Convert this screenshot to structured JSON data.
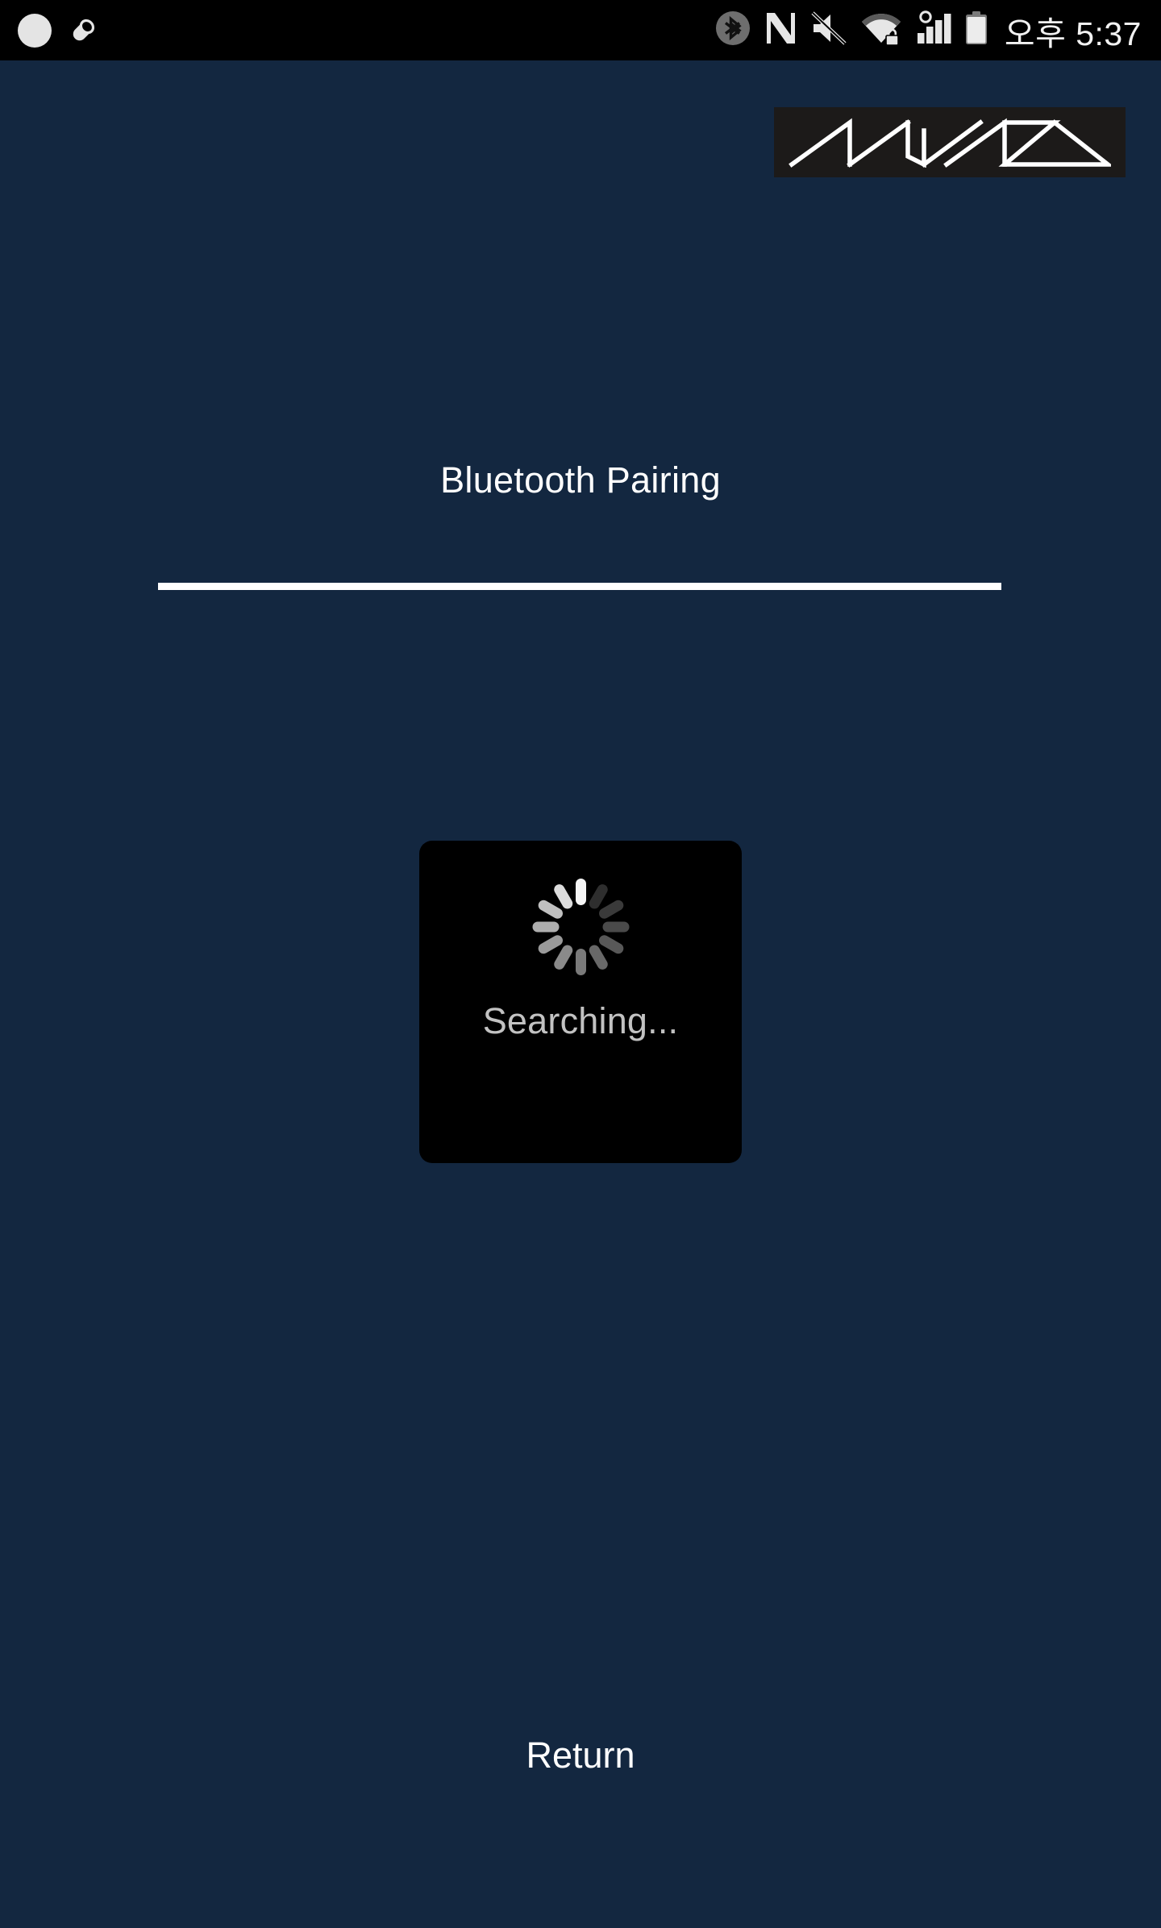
{
  "status_bar": {
    "background_color": "#000000",
    "left_icons": [
      {
        "name": "notification-dot-icon",
        "glyph": "circle"
      },
      {
        "name": "capsule-notification-icon",
        "glyph": "pill"
      }
    ],
    "right_icons": [
      {
        "name": "bluetooth-icon",
        "label": "Bluetooth",
        "color": "#6e6e6e"
      },
      {
        "name": "nfc-icon",
        "label": "NFC",
        "color": "#e6e6e6"
      },
      {
        "name": "volume-mute-icon",
        "label": "Muted",
        "color": "#e6e6e6"
      },
      {
        "name": "wifi-secured-icon",
        "label": "Wi-Fi secured",
        "color": "#e6e6e6"
      },
      {
        "name": "cellular-signal-icon",
        "label": "Signal",
        "color": "#e6e6e6"
      },
      {
        "name": "battery-icon",
        "label": "Battery",
        "color": "#e6e6e6"
      }
    ],
    "clock": "오후 5:37"
  },
  "brand": {
    "logo_name": "navis-logo",
    "logo_text": "NAVIS",
    "box_color": "#1c1a19",
    "stroke_color": "#ffffff"
  },
  "main": {
    "title": "Bluetooth Pairing",
    "divider_color": "#ffffff",
    "background_color": "#132740"
  },
  "dialog": {
    "label": "Searching...",
    "background_color": "#000000",
    "text_color": "#c2c2c2",
    "spinner": {
      "name": "loading-spinner",
      "spoke_count": 12,
      "spoke_colors": [
        "#f4f4f4",
        "#2e2e2e",
        "#3a3a3a",
        "#4a4a4a",
        "#585858",
        "#686868",
        "#7a7a7a",
        "#8a8a8a",
        "#9a9a9a",
        "#aeaeae",
        "#c0c0c0",
        "#dcdcdc"
      ]
    }
  },
  "footer": {
    "return_label": "Return"
  }
}
